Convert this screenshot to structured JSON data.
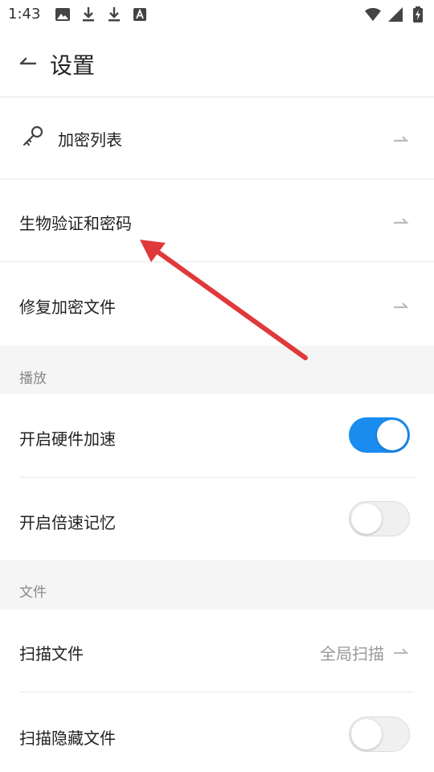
{
  "status_bar": {
    "time": "1:43",
    "left_icons": [
      "image-icon",
      "download-icon",
      "download-icon",
      "font-icon"
    ],
    "right_icons": [
      "wifi-icon",
      "signal-icon",
      "battery-icon"
    ]
  },
  "header": {
    "title": "设置"
  },
  "encryption": {
    "items": [
      {
        "label": "加密列表",
        "icon": "key-icon"
      },
      {
        "label": "生物验证和密码"
      },
      {
        "label": "修复加密文件"
      }
    ]
  },
  "playback": {
    "section_title": "播放",
    "items": [
      {
        "label": "开启硬件加速",
        "enabled": true
      },
      {
        "label": "开启倍速记忆",
        "enabled": false
      }
    ]
  },
  "files": {
    "section_title": "文件",
    "items": [
      {
        "label": "扫描文件",
        "value": "全局扫描"
      },
      {
        "label": "扫描隐藏文件",
        "enabled": false
      }
    ]
  },
  "colors": {
    "accent": "#1a8cf0",
    "annotation": "#e0393b"
  }
}
